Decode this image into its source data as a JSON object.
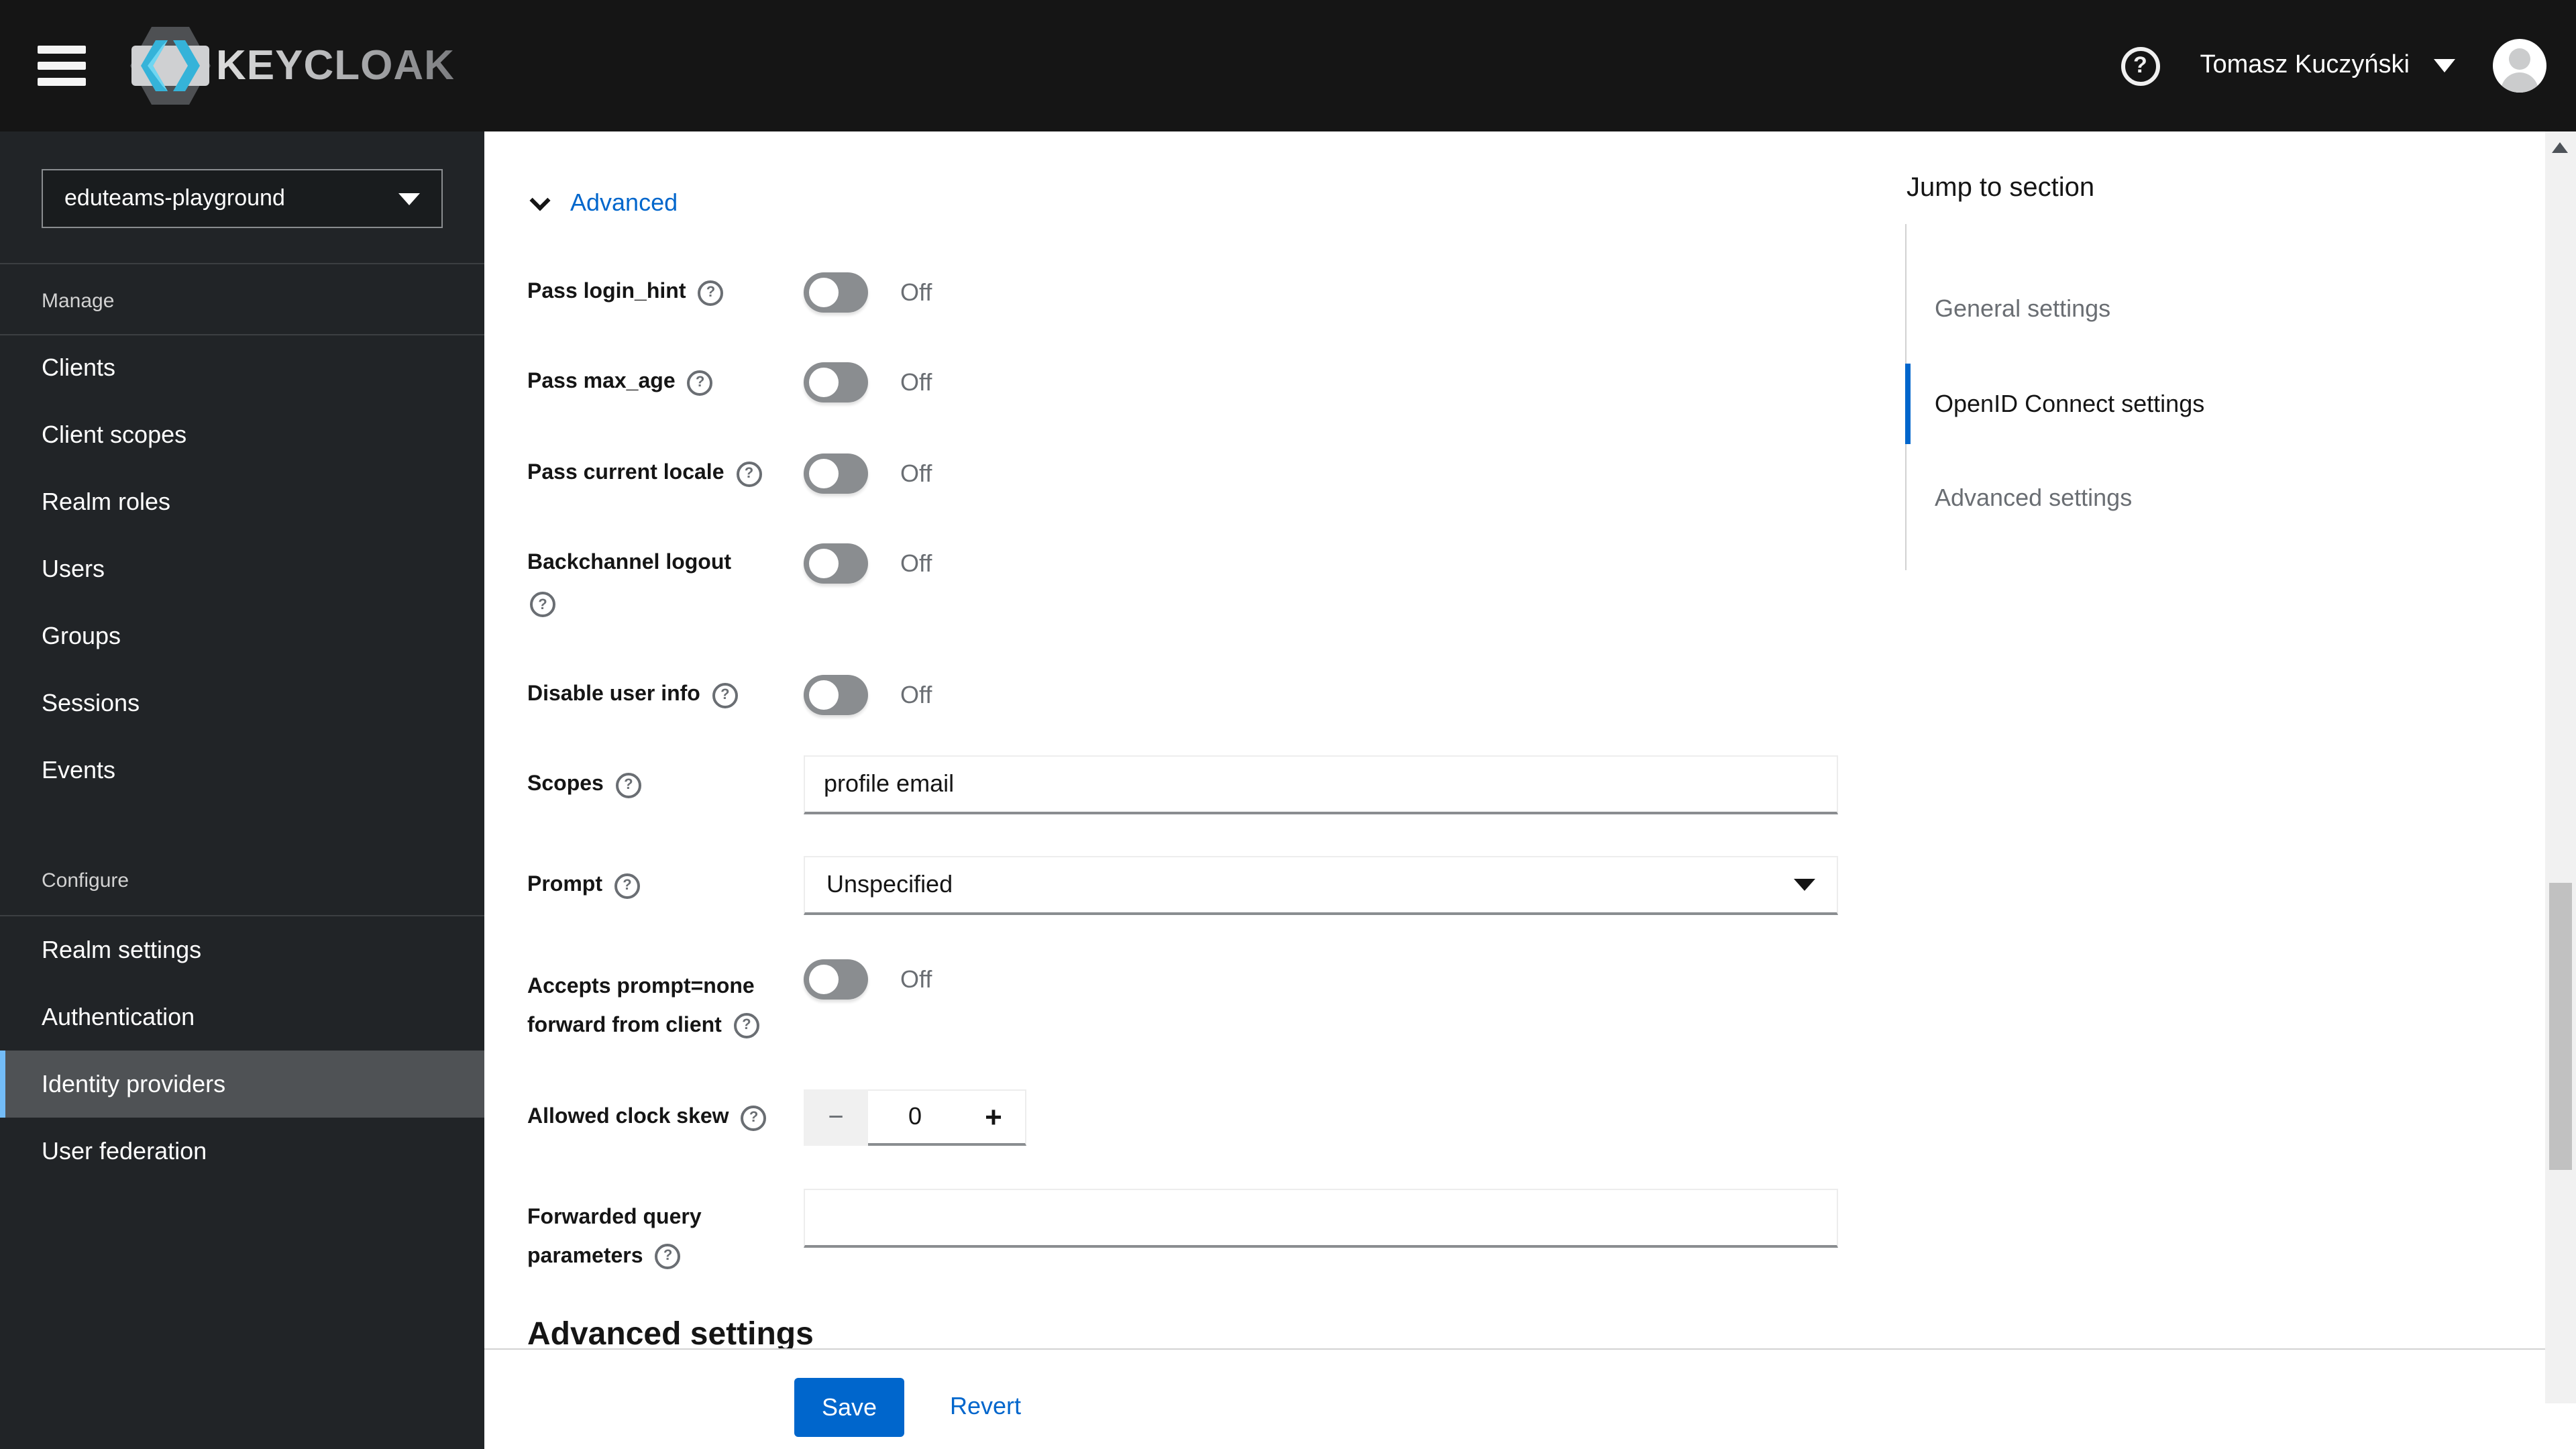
{
  "colors": {
    "primary_blue": "#0066cc",
    "masthead_bg": "#151515",
    "sidebar_bg": "#212427",
    "sidebar_selected_bg": "#4f5255",
    "sidebar_selected_accent": "#73bcf7",
    "toggle_off_bg": "#8a8d90",
    "muted_text": "#6a6e73"
  },
  "icons": {
    "hamburger": "≡",
    "help": "?",
    "minus": "−",
    "plus": "+"
  },
  "header": {
    "brand_text": "KEYCLOAK",
    "user_name": "Tomasz Kuczyński"
  },
  "sidebar": {
    "realm_selector_value": "eduteams-playground",
    "groups": [
      {
        "label": "Manage",
        "items": [
          "Clients",
          "Client scopes",
          "Realm roles",
          "Users",
          "Groups",
          "Sessions",
          "Events"
        ]
      },
      {
        "label": "Configure",
        "items": [
          "Realm settings",
          "Authentication",
          "Identity providers",
          "User federation"
        ],
        "active_item": "Identity providers"
      }
    ]
  },
  "main": {
    "expandable_label": "Advanced",
    "toggle_rows": [
      {
        "label": "Pass login_hint",
        "state": "Off"
      },
      {
        "label": "Pass max_age",
        "state": "Off"
      },
      {
        "label": "Pass current locale",
        "state": "Off"
      },
      {
        "label": "Backchannel logout",
        "state": "Off"
      },
      {
        "label": "Disable user info",
        "state": "Off"
      }
    ],
    "scopes": {
      "label": "Scopes",
      "value": "profile email"
    },
    "prompt": {
      "label": "Prompt",
      "value": "Unspecified"
    },
    "accepts_prompt_none": {
      "label_line1": "Accepts prompt=none",
      "label_line2": "forward from client",
      "state": "Off"
    },
    "clock_skew": {
      "label": "Allowed clock skew",
      "value": "0"
    },
    "forwarded_query": {
      "label_line1": "Forwarded query",
      "label_line2": "parameters",
      "value": ""
    },
    "section_heading": "Advanced settings",
    "footer": {
      "save_label": "Save",
      "revert_label": "Revert"
    }
  },
  "jump": {
    "title": "Jump to section",
    "items": [
      {
        "label": "General settings",
        "active": false
      },
      {
        "label": "OpenID Connect settings",
        "active": true
      },
      {
        "label": "Advanced settings",
        "active": false
      }
    ]
  }
}
